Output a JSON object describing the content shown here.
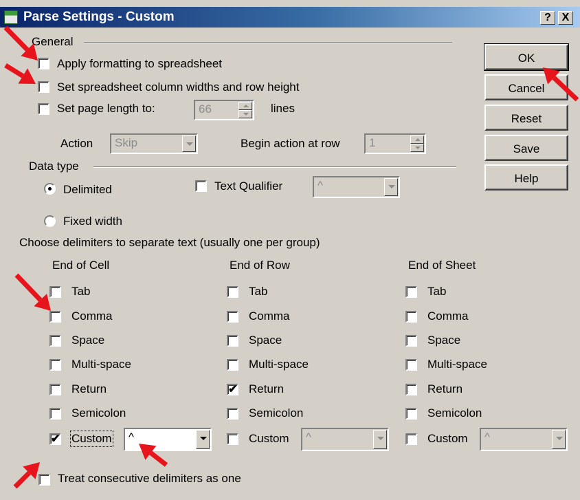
{
  "window": {
    "title": "Parse Settings - Custom",
    "help_btn": "?",
    "close_btn": "X"
  },
  "general": {
    "group_label": "General",
    "apply_formatting": "Apply formatting to spreadsheet",
    "set_column_widths": "Set spreadsheet column widths and row height",
    "set_page_length": "Set page length to:",
    "page_length_value": "66",
    "lines_label": "lines",
    "action_label": "Action",
    "action_value": "Skip",
    "begin_action_label": "Begin action at row",
    "begin_action_value": "1"
  },
  "data_type": {
    "group_label": "Data type",
    "delimited": "Delimited",
    "fixed_width": "Fixed width",
    "text_qualifier": "Text Qualifier",
    "text_qualifier_value": "^"
  },
  "delimiters": {
    "instruction": "Choose delimiters to separate text (usually one per group)",
    "columns": [
      {
        "header": "End of Cell",
        "items": [
          {
            "label": "Tab",
            "checked": false
          },
          {
            "label": "Comma",
            "checked": false
          },
          {
            "label": "Space",
            "checked": false
          },
          {
            "label": "Multi-space",
            "checked": false
          },
          {
            "label": "Return",
            "checked": false
          },
          {
            "label": "Semicolon",
            "checked": false
          },
          {
            "label": "Custom",
            "checked": true
          }
        ],
        "custom_value": "^"
      },
      {
        "header": "End of Row",
        "items": [
          {
            "label": "Tab",
            "checked": false
          },
          {
            "label": "Comma",
            "checked": false
          },
          {
            "label": "Space",
            "checked": false
          },
          {
            "label": "Multi-space",
            "checked": false
          },
          {
            "label": "Return",
            "checked": true
          },
          {
            "label": "Semicolon",
            "checked": false
          },
          {
            "label": "Custom",
            "checked": false
          }
        ],
        "custom_value": "^"
      },
      {
        "header": "End of Sheet",
        "items": [
          {
            "label": "Tab",
            "checked": false
          },
          {
            "label": "Comma",
            "checked": false
          },
          {
            "label": "Space",
            "checked": false
          },
          {
            "label": "Multi-space",
            "checked": false
          },
          {
            "label": "Return",
            "checked": false
          },
          {
            "label": "Semicolon",
            "checked": false
          },
          {
            "label": "Custom",
            "checked": false
          }
        ],
        "custom_value": "^"
      }
    ],
    "treat_consecutive": "Treat consecutive delimiters as one"
  },
  "buttons": {
    "ok": "OK",
    "cancel": "Cancel",
    "reset": "Reset",
    "save": "Save",
    "help": "Help"
  },
  "check_mark": "✔",
  "colors": {
    "dialog_bg": "#d4d0c8",
    "titlebar_start": "#0a246a",
    "titlebar_end": "#a6caf0",
    "annotation_arrow": "#e8141c"
  }
}
